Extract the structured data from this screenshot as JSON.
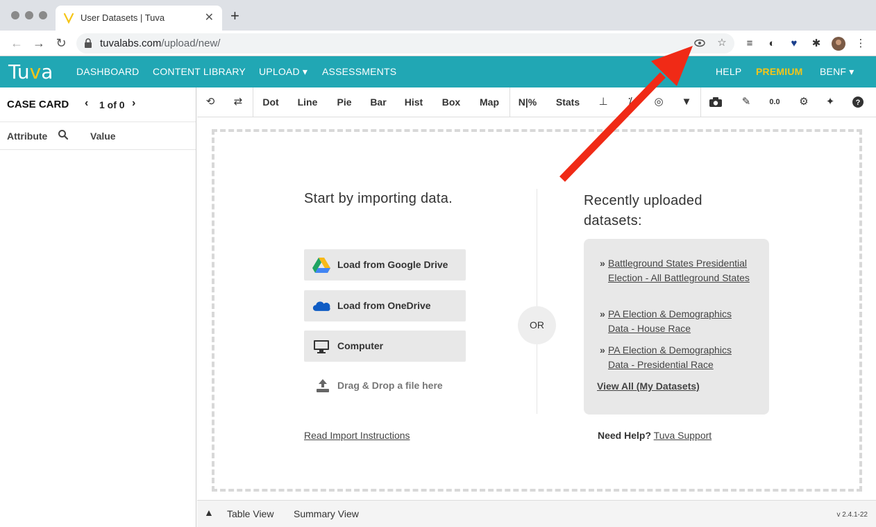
{
  "browser": {
    "tab_title": "User Datasets | Tuva",
    "url_host": "tuvalabs.com",
    "url_path": "/upload/new/",
    "new_tab": "+",
    "close_tab": "✕"
  },
  "app": {
    "logo": "Tuva",
    "nav": {
      "dashboard": "DASHBOARD",
      "content_library": "CONTENT LIBRARY",
      "upload": "UPLOAD ▾",
      "assessments": "ASSESSMENTS",
      "help": "HELP",
      "premium": "PREMIUM",
      "user": "BENF ▾"
    },
    "accent_color": "#21a7b4",
    "premium_color": "#f5c518"
  },
  "case_card": {
    "title": "CASE CARD",
    "count": "1 of 0",
    "attribute_header": "Attribute",
    "value_header": "Value"
  },
  "graph_toolbar": {
    "dot": "Dot",
    "line": "Line",
    "pie": "Pie",
    "bar": "Bar",
    "hist": "Hist",
    "box": "Box",
    "map": "Map",
    "n_percent": "N|%",
    "stats": "Stats"
  },
  "import": {
    "title": "Start by importing data.",
    "google_drive": "Load from Google Drive",
    "onedrive": "Load from OneDrive",
    "computer": "Computer",
    "drag_drop": "Drag & Drop a file here",
    "read_instructions": "Read Import Instructions",
    "or": "OR"
  },
  "recent": {
    "title": "Recently uploaded datasets:",
    "items": [
      "Battleground States Presidential Election - All Battleground States",
      "PA Election & Demographics Data - House Race",
      "PA Election & Demographics Data - Presidential Race"
    ],
    "bullet": "»",
    "view_all": "View All (My Datasets)",
    "need_help": "Need Help?",
    "support": "Tuva Support"
  },
  "bottom": {
    "table_view": "Table View",
    "summary_view": "Summary View",
    "version": "v 2.4.1-22"
  }
}
